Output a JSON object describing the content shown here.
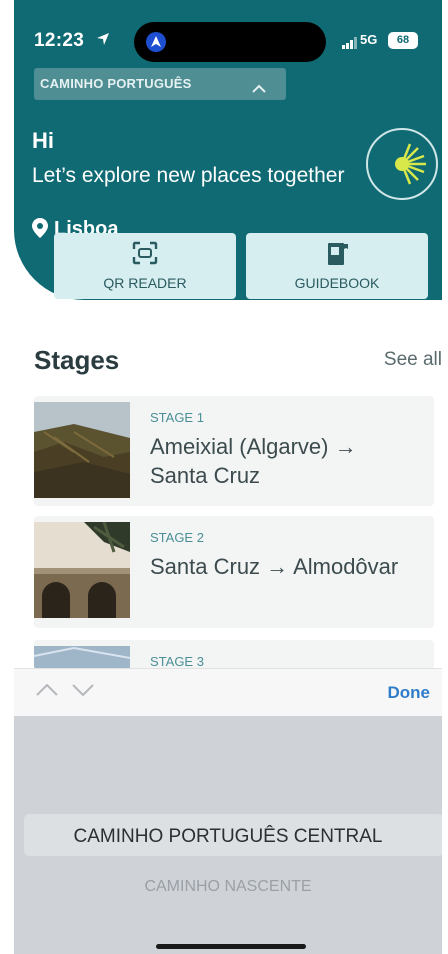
{
  "status": {
    "time": "12:23",
    "network": "5G",
    "battery": "68"
  },
  "header": {
    "route_select": "CAMINHO PORTUGUÊS",
    "greeting": "Hi",
    "subtitle": "Let’s explore new places together",
    "location": "Lisboa"
  },
  "quick_actions": {
    "qr_label": "QR READER",
    "guide_label": "GUIDEBOOK"
  },
  "stages": {
    "title": "Stages",
    "see_all": "See all",
    "items": [
      {
        "number": "STAGE 1",
        "name": "Ameixial (Algarve) → Santa Cruz"
      },
      {
        "number": "STAGE 2",
        "name": "Santa Cruz → Almodôvar"
      },
      {
        "number": "STAGE 3"
      }
    ]
  },
  "keyboard": {
    "done_label": "Done"
  },
  "picker": {
    "options": [
      "CAMINHO PORTUGUÊS CENTRAL",
      "CAMINHO NASCENTE"
    ]
  },
  "colors": {
    "header_teal": "#0f6a73",
    "accent_light": "#d6eef0",
    "done_blue": "#2f7dc9"
  },
  "icons": [
    "location-arrow-icon",
    "app-icon",
    "signal-icon",
    "chevron-up-icon",
    "map-pin-icon",
    "qr-scan-icon",
    "book-icon",
    "chevron-down-icon"
  ]
}
